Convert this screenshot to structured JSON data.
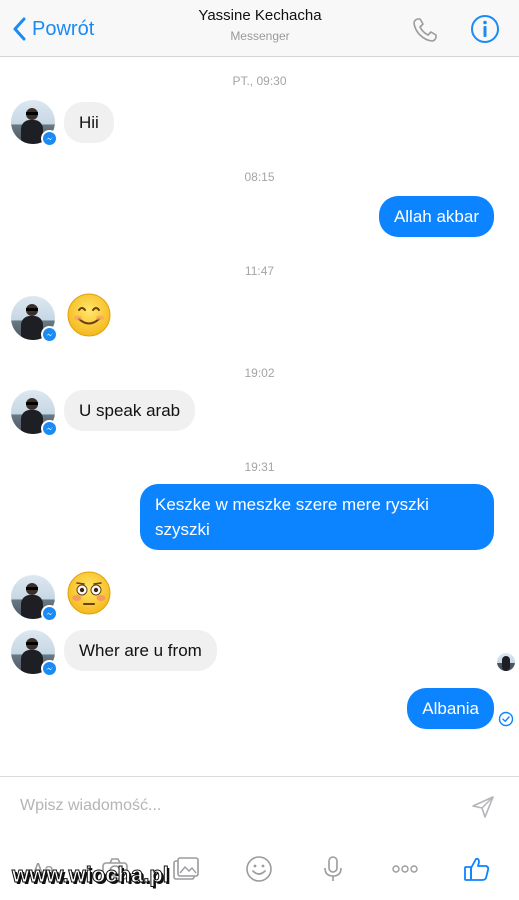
{
  "header": {
    "back_label": "Powrót",
    "contact_name": "Yassine Kechacha",
    "subtitle": "Messenger"
  },
  "timestamps": [
    "PT., 09:30",
    "08:15",
    "11:47",
    "19:02",
    "19:31"
  ],
  "messages": [
    {
      "from": "contact",
      "type": "text",
      "text": "Hii"
    },
    {
      "from": "me",
      "type": "text",
      "text": "Allah akbar"
    },
    {
      "from": "contact",
      "type": "emoji",
      "emoji": "smiling-face-icon"
    },
    {
      "from": "contact",
      "type": "text",
      "text": "U speak arab"
    },
    {
      "from": "me",
      "type": "text",
      "text": "Keszke w meszke szere mere ryszki szyszki"
    },
    {
      "from": "contact",
      "type": "emoji",
      "emoji": "flushed-face-icon"
    },
    {
      "from": "contact",
      "type": "text",
      "text": "Wher are u from"
    },
    {
      "from": "me",
      "type": "text",
      "text": "Albania"
    }
  ],
  "composer": {
    "placeholder": "Wpisz wiadomość..."
  },
  "watermark": "www.wiocha.pl",
  "colors": {
    "accent": "#0c84ff",
    "incoming_bubble": "#f1f0f0",
    "timestamp": "#a4a4a8"
  }
}
